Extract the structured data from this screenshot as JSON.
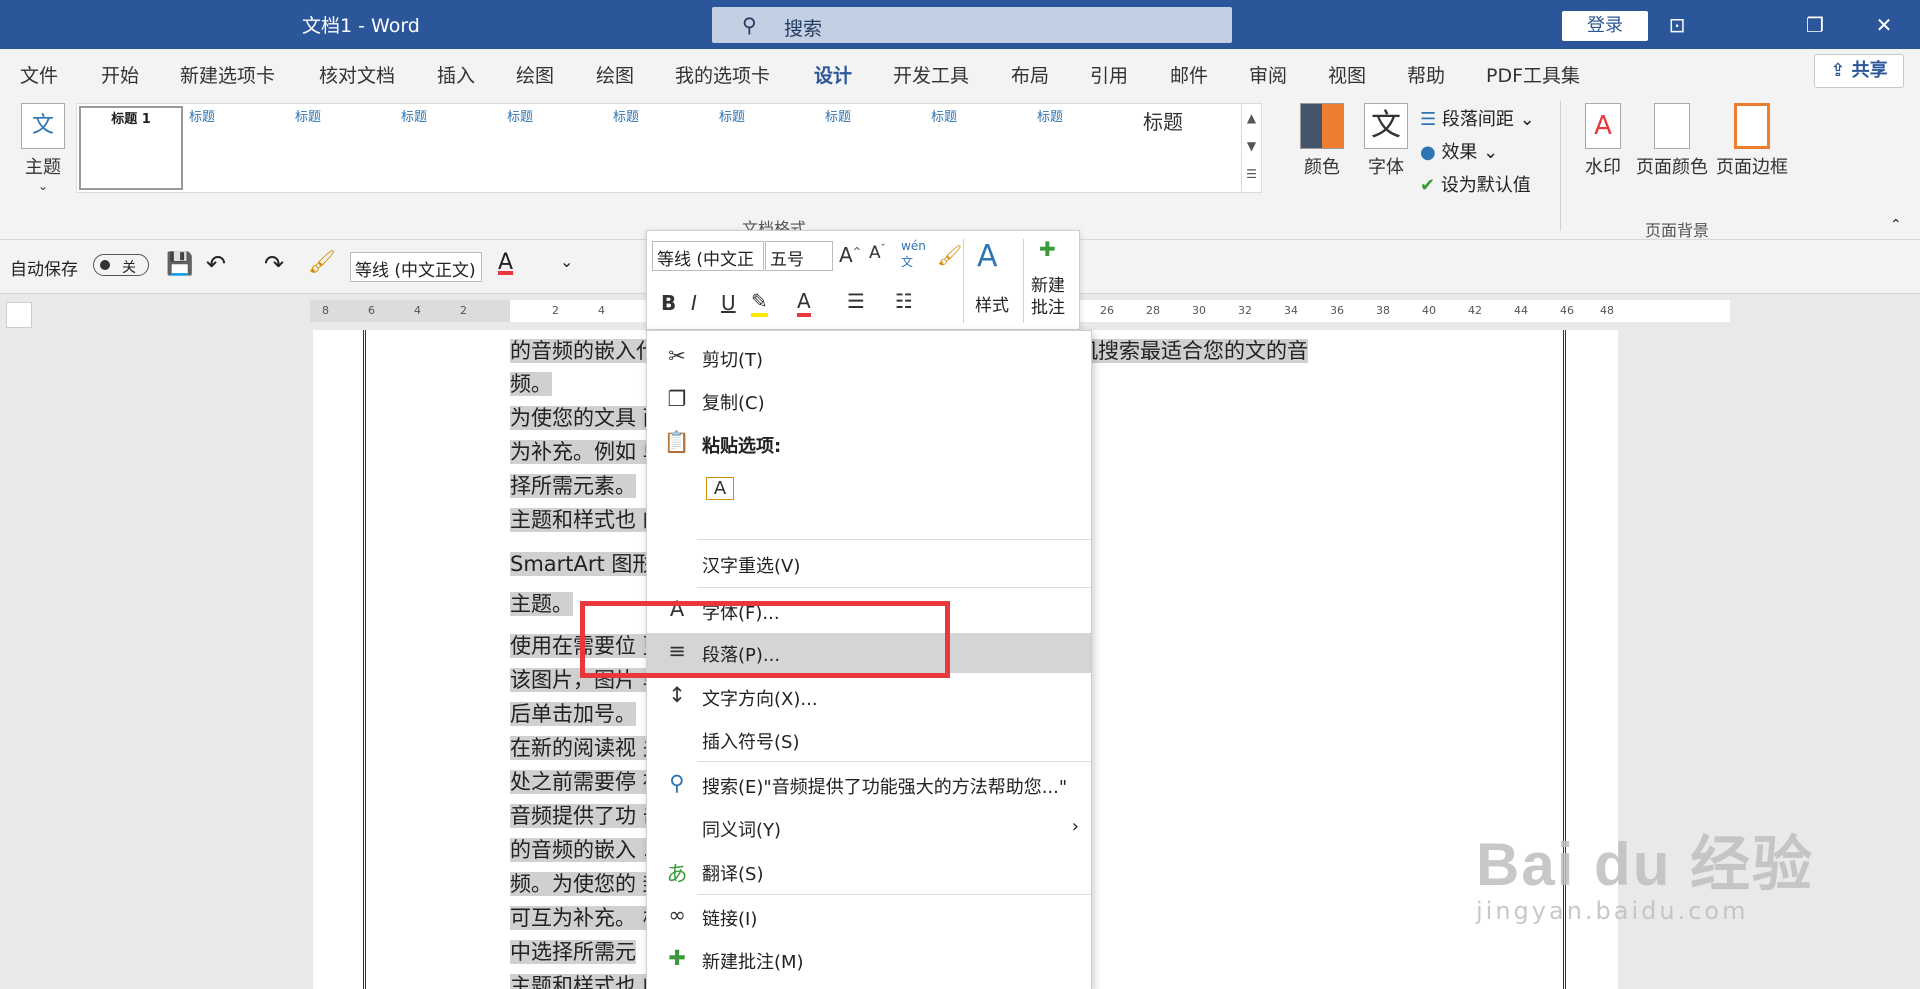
{
  "titlebar": {
    "title": "文档1  -  Word",
    "search_placeholder": "搜索",
    "login": "登录"
  },
  "tabs": [
    "文件",
    "开始",
    "新建选项卡",
    "核对文档",
    "插入",
    "绘图",
    "绘图",
    "我的选项卡",
    "设计",
    "开发工具",
    "布局",
    "引用",
    "邮件",
    "审阅",
    "视图",
    "帮助",
    "PDF工具集"
  ],
  "active_tab": "设计",
  "share": "共享",
  "ribbon": {
    "theme": "主题",
    "gallery_label": "文档格式",
    "gallery_items": [
      {
        "h": "标题 1"
      },
      {
        "h": "标题"
      },
      {
        "h": "标题"
      },
      {
        "h": "标题"
      },
      {
        "h": "标题"
      },
      {
        "h": "标题"
      },
      {
        "h": "标题"
      },
      {
        "h": "标题"
      },
      {
        "h": "标题"
      },
      {
        "h": "标题"
      },
      {
        "h": "标题"
      }
    ],
    "colors": "颜色",
    "fonts": "字体",
    "paragraph_spacing": "段落间距",
    "effects": "效果",
    "set_default": "设为默认值",
    "watermark": "水印",
    "page_color": "页面颜色",
    "page_border": "页面边框",
    "page_background": "页面背景"
  },
  "qat": {
    "autosave": "自动保存",
    "toggle": "关",
    "font_name": "等线 (中文正文)"
  },
  "minibar": {
    "font": "等线 (中文正",
    "size": "五号",
    "styles": "样式",
    "new_comment": "新建\n批注"
  },
  "ruler_ticks": [
    "8",
    "6",
    "4",
    "2",
    "2",
    "4",
    "26",
    "28",
    "30",
    "32",
    "34",
    "36",
    "38",
    "40",
    "42",
    "44",
    "46",
    "48"
  ],
  "doc_lines": [
    "的音频的嵌入代码中进行粘贴。您也可以键入一个关键字以联机搜索最适合您的文的音",
    "频。",
    "为使您的文具                                              面和文本框设计，这些设计可互",
    "为补充。例如                                              单击“插入”，然后从不同库中选",
    "择所需元素。",
    "主题和样式也                                              的主题时，图片、图表或",
    "SmartArt 图形                                             您的标题会进行更改以匹配新的",
    "主题。",
    "使用在需要位                                              更改图片适应文的方式，请单击",
    "该图片，图片                                              单击要添加行或列的位置，然",
    "后单击加号。",
    "在新的阅读视                                              关注所需文本。如果在达到结尾",
    "处之前需要停                                              在另一个设备上。",
    "音频提供了功                                              击联机音频时，可以在想要添加",
    "的音频的嵌入                                              以联机搜索最适合您的文的音",
    "频。为使您的                                              封面和文本框设计，这些设计",
    "可互为补充。                                              栏。单击“插入”，然后从不同库",
    "中选择所需元",
    "主题和样式也                                              的主题时，图片、图表或"
  ],
  "context_menu": [
    {
      "icon": "cut-icon",
      "glyph": "✂",
      "label": "剪切(T)"
    },
    {
      "icon": "copy-icon",
      "glyph": "❐",
      "label": "复制(C)"
    },
    {
      "icon": "paste-options-icon",
      "glyph": "📋",
      "label": "粘贴选项:"
    },
    {
      "icon": "keep-text-only-icon",
      "glyph": "A",
      "label": ""
    },
    {
      "icon": "",
      "glyph": "",
      "label": "汉字重选(V)"
    },
    {
      "icon": "font-icon",
      "glyph": "A",
      "label": "字体(F)..."
    },
    {
      "icon": "paragraph-icon",
      "glyph": "≡",
      "label": "段落(P)..."
    },
    {
      "icon": "text-direction-icon",
      "glyph": "↕",
      "label": "文字方向(X)..."
    },
    {
      "icon": "",
      "glyph": "",
      "label": "插入符号(S)"
    },
    {
      "icon": "search-icon",
      "glyph": "⚲",
      "label": "搜索(E)\"音频提供了功能强大的方法帮助您...\""
    },
    {
      "icon": "",
      "glyph": "",
      "label": "同义词(Y)"
    },
    {
      "icon": "translate-icon",
      "glyph": "あ",
      "label": "翻译(S)"
    },
    {
      "icon": "link-icon",
      "glyph": "∞",
      "label": "链接(I)"
    },
    {
      "icon": "new-comment-icon",
      "glyph": "✚",
      "label": "新建批注(M)"
    }
  ],
  "watermark": {
    "brand": "Bai du 经验",
    "url": "jingyan.baidu.com"
  }
}
